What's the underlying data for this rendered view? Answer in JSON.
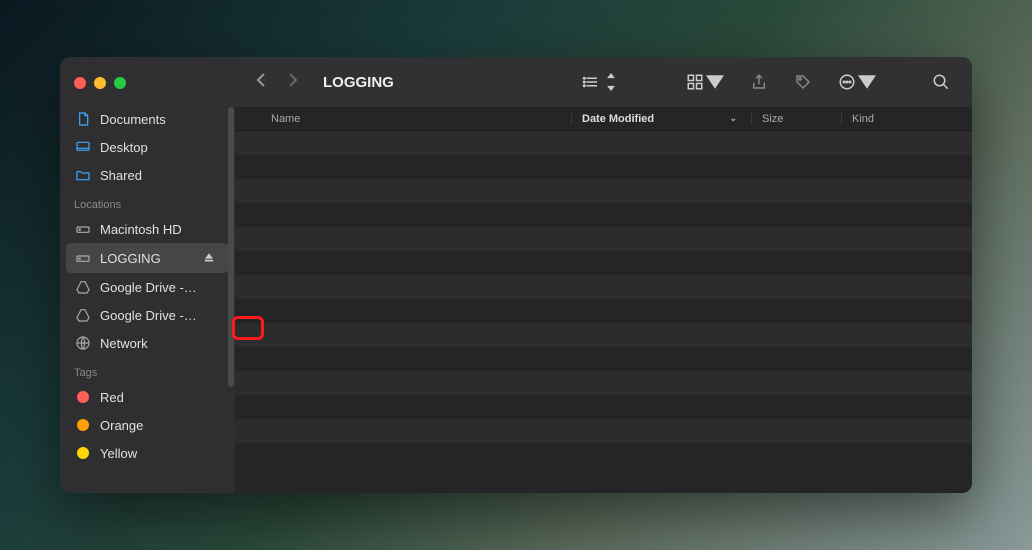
{
  "window": {
    "title": "LOGGING"
  },
  "sidebar": {
    "favorites": [
      {
        "label": "Documents",
        "icon": "document"
      },
      {
        "label": "Desktop",
        "icon": "desktop"
      },
      {
        "label": "Shared",
        "icon": "folder"
      }
    ],
    "locations_header": "Locations",
    "locations": [
      {
        "label": "Macintosh HD",
        "icon": "hdd",
        "ejectable": false,
        "selected": false
      },
      {
        "label": "LOGGING",
        "icon": "hdd",
        "ejectable": true,
        "selected": true
      },
      {
        "label": "Google Drive -…",
        "icon": "gdrive",
        "ejectable": true,
        "selected": false
      },
      {
        "label": "Google Drive -…",
        "icon": "gdrive",
        "ejectable": true,
        "selected": false
      },
      {
        "label": "Network",
        "icon": "network",
        "ejectable": false,
        "selected": false
      }
    ],
    "tags_header": "Tags",
    "tags": [
      {
        "label": "Red",
        "color": "#ff5f57"
      },
      {
        "label": "Orange",
        "color": "#ff9f0a"
      },
      {
        "label": "Yellow",
        "color": "#ffd60a"
      }
    ]
  },
  "columns": {
    "name": "Name",
    "date": "Date Modified",
    "size": "Size",
    "kind": "Kind"
  },
  "rows_count": 14
}
